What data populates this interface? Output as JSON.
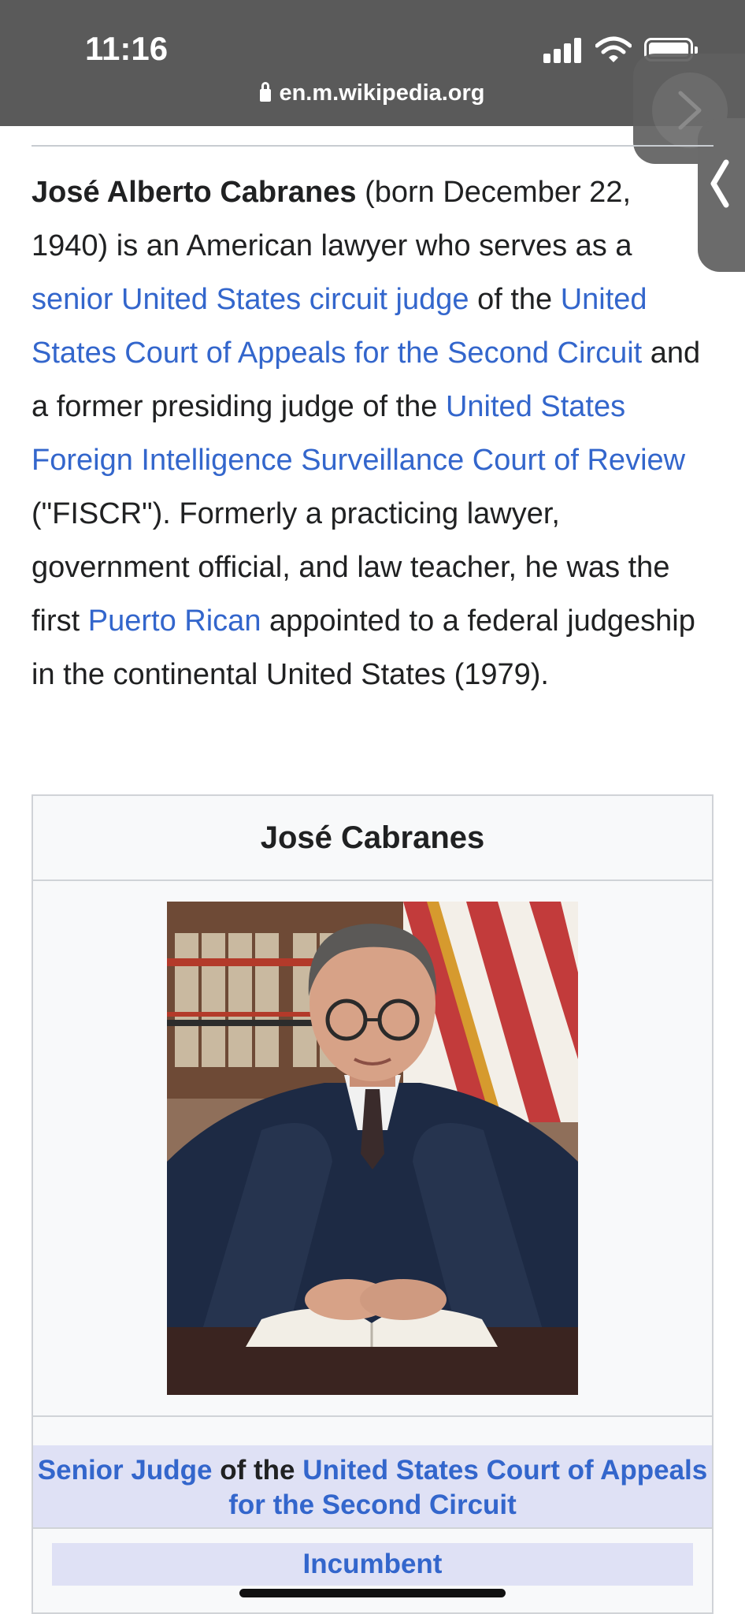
{
  "status_bar": {
    "time": "11:16",
    "url": "en.m.wikipedia.org"
  },
  "intro": {
    "subject_name": "José Alberto Cabranes",
    "t1": " (born December 22, 1940) is an American lawyer who serves as a ",
    "link1": "senior United States circuit judge",
    "t2": " of the ",
    "link2": "United States Court of Appeals for the Second Circuit",
    "t3": " and a former presiding judge of the ",
    "link3": "United States Foreign Intelligence Surveillance Court of Review",
    "t4": " (\"FISCR\"). Formerly a practicing lawyer, government official, and law teacher, he was the first ",
    "link4": "Puerto Rican",
    "t5": " appointed to a federal judgeship in the continental United States (1979)."
  },
  "infobox": {
    "title": "José Cabranes",
    "role_link1": "Senior Judge",
    "role_of": " of the ",
    "role_link2": "United States Court of Appeals for the Second Circuit",
    "incumbent": "Incumbent"
  },
  "colors": {
    "link": "#3366cc",
    "status_bar": "#5a5a5a",
    "infobox_header": "#dfe1f5"
  }
}
